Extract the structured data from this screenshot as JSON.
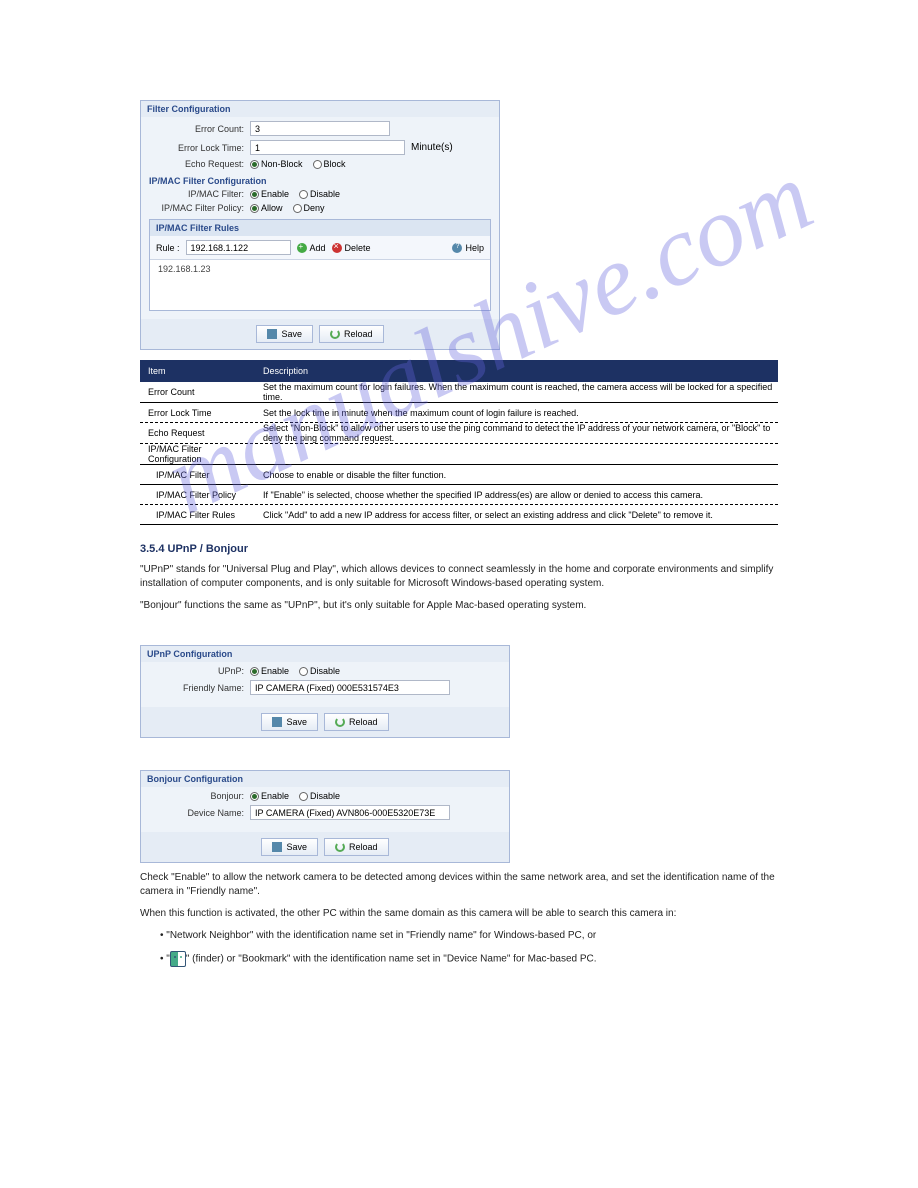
{
  "filter_config": {
    "title": "Filter Configuration",
    "error_count_label": "Error Count:",
    "error_count_value": "3",
    "error_lock_label": "Error Lock Time:",
    "error_lock_value": "1",
    "minutes": "Minute(s)",
    "echo_label": "Echo Request:",
    "echo_nonblock": "Non-Block",
    "echo_block": "Block"
  },
  "ipmac": {
    "title": "IP/MAC Filter Configuration",
    "filter_label": "IP/MAC Filter:",
    "enable": "Enable",
    "disable": "Disable",
    "policy_label": "IP/MAC Filter Policy:",
    "allow": "Allow",
    "deny": "Deny",
    "rules_title": "IP/MAC Filter Rules",
    "rule_label": "Rule :",
    "rule_value": "192.168.1.122",
    "add": "Add",
    "delete": "Delete",
    "help": "Help",
    "rule_list_item": "192.168.1.23"
  },
  "buttons": {
    "save": "Save",
    "reload": "Reload"
  },
  "table": {
    "header_item": "Item",
    "header_desc": "Description",
    "rows": [
      {
        "c1": "Error Count",
        "c2": "Set the maximum count for login failures. When the maximum count is reached, the camera access will be locked for a specified time."
      },
      {
        "c1": "Error Lock Time",
        "c2": "Set the lock time in minute when the maximum count of login failure is reached."
      },
      {
        "c1": "Echo Request",
        "c2": "Select \"Non-Block\" to allow other users to use the ping command to detect the IP address of your network camera, or \"Block\" to deny the ping command request."
      },
      {
        "c1": "IP/MAC Filter Configuration",
        "c2": ""
      },
      {
        "c1": "IP/MAC Filter",
        "c2": "Choose to enable or disable the filter function."
      },
      {
        "c1": "IP/MAC Filter Policy",
        "c2": "If \"Enable\" is selected, choose whether the specified IP address(es) are allow or denied to access this camera."
      },
      {
        "c1": "IP/MAC Filter Rules",
        "c2": "Click \"Add\" to add a new IP address for access filter, or select an existing address and click \"Delete\" to remove it."
      }
    ]
  },
  "upnp_section": {
    "heading": "3.5.4 UPnP / Bonjour",
    "para1": "\"UPnP\" stands for \"Universal Plug and Play\", which allows devices to connect seamlessly in the home and corporate environments and simplify installation of computer components, and is only suitable for Microsoft Windows-based operating system.",
    "para2": "\"Bonjour\" functions the same as \"UPnP\", but it's only suitable for Apple Mac-based operating system."
  },
  "upnp_panel": {
    "title": "UPnP Configuration",
    "label": "UPnP:",
    "enable": "Enable",
    "disable": "Disable",
    "friendly_label": "Friendly Name:",
    "friendly_value": "IP CAMERA (Fixed) 000E531574E3"
  },
  "bonjour_panel": {
    "title": "Bonjour Configuration",
    "label": "Bonjour:",
    "enable": "Enable",
    "disable": "Disable",
    "device_label": "Device Name:",
    "device_value": "IP CAMERA (Fixed) AVN806-000E5320E73E"
  },
  "bottom_text": {
    "p1": "Check \"Enable\" to allow the network camera to be detected among devices within the same network area, and set the identification name of the camera in \"Friendly name\".",
    "p2": "When this function is activated, the other PC within the same domain as this camera will be able to search this camera in:",
    "b1": "\"Network Neighbor\" with the identification name set in \"Friendly name\" for Windows-based PC, or",
    "b2a": "\"",
    "b2b": "\" (finder) or \"Bookmark\" with the identification name set in \"Device Name\" for Mac-based PC."
  }
}
